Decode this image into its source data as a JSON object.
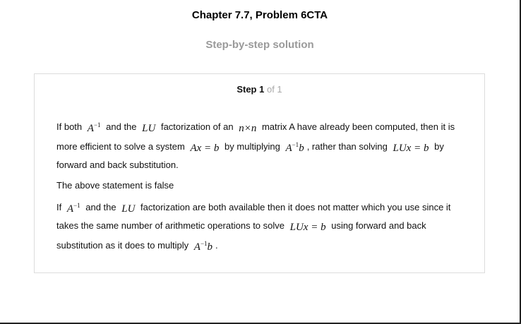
{
  "header": {
    "chapter_title": "Chapter 7.7, Problem 6CTA",
    "subtitle": "Step-by-step solution"
  },
  "step": {
    "label": "Step 1",
    "of": "of 1"
  },
  "paragraph1": {
    "t1": "If both",
    "m1_base": "A",
    "m1_sup": "−1",
    "t2": "and the",
    "m2": "LU",
    "t3": "factorization of an",
    "m3": "n×n",
    "t4": "matrix A have already been computed, then it is more efficient to solve a system",
    "m4": "Ax = b",
    "t5": "by multiplying",
    "m5_base": "A",
    "m5_sup": "−1",
    "m5_tail": "b",
    "t6": ", rather than solving",
    "m6": "LUx = b",
    "t7": "by forward and back substitution."
  },
  "paragraph2": {
    "text": "The above statement is false"
  },
  "paragraph3": {
    "t1": "If",
    "m1_base": "A",
    "m1_sup": "−1",
    "t2": "and the",
    "m2": "LU",
    "t3": "factorization are both available then it does not matter which you use since it takes the same number of arithmetic operations to solve",
    "m3": "LUx = b",
    "t4": "using forward and back substitution as it does to multiply",
    "m4_base": "A",
    "m4_sup": "−1",
    "m4_tail": "b",
    "t5": "."
  }
}
